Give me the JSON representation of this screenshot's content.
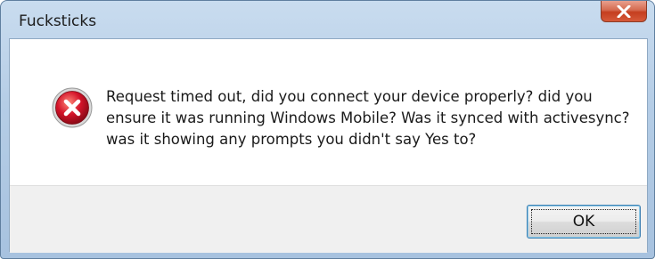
{
  "window": {
    "title": "Fucksticks"
  },
  "dialog": {
    "icon": "error-icon",
    "message": "Request timed out, did you connect your device properly? did you ensure it was running Windows Mobile? Was it synced with activesync? was it showing any prompts you didn't say Yes to?",
    "ok_label": "OK"
  },
  "colors": {
    "titlebar": "#b5cde6",
    "close_button": "#c43e1f",
    "error_icon": "#c8102e",
    "footer": "#f0f0f0",
    "button_border": "#3c7fb1"
  }
}
